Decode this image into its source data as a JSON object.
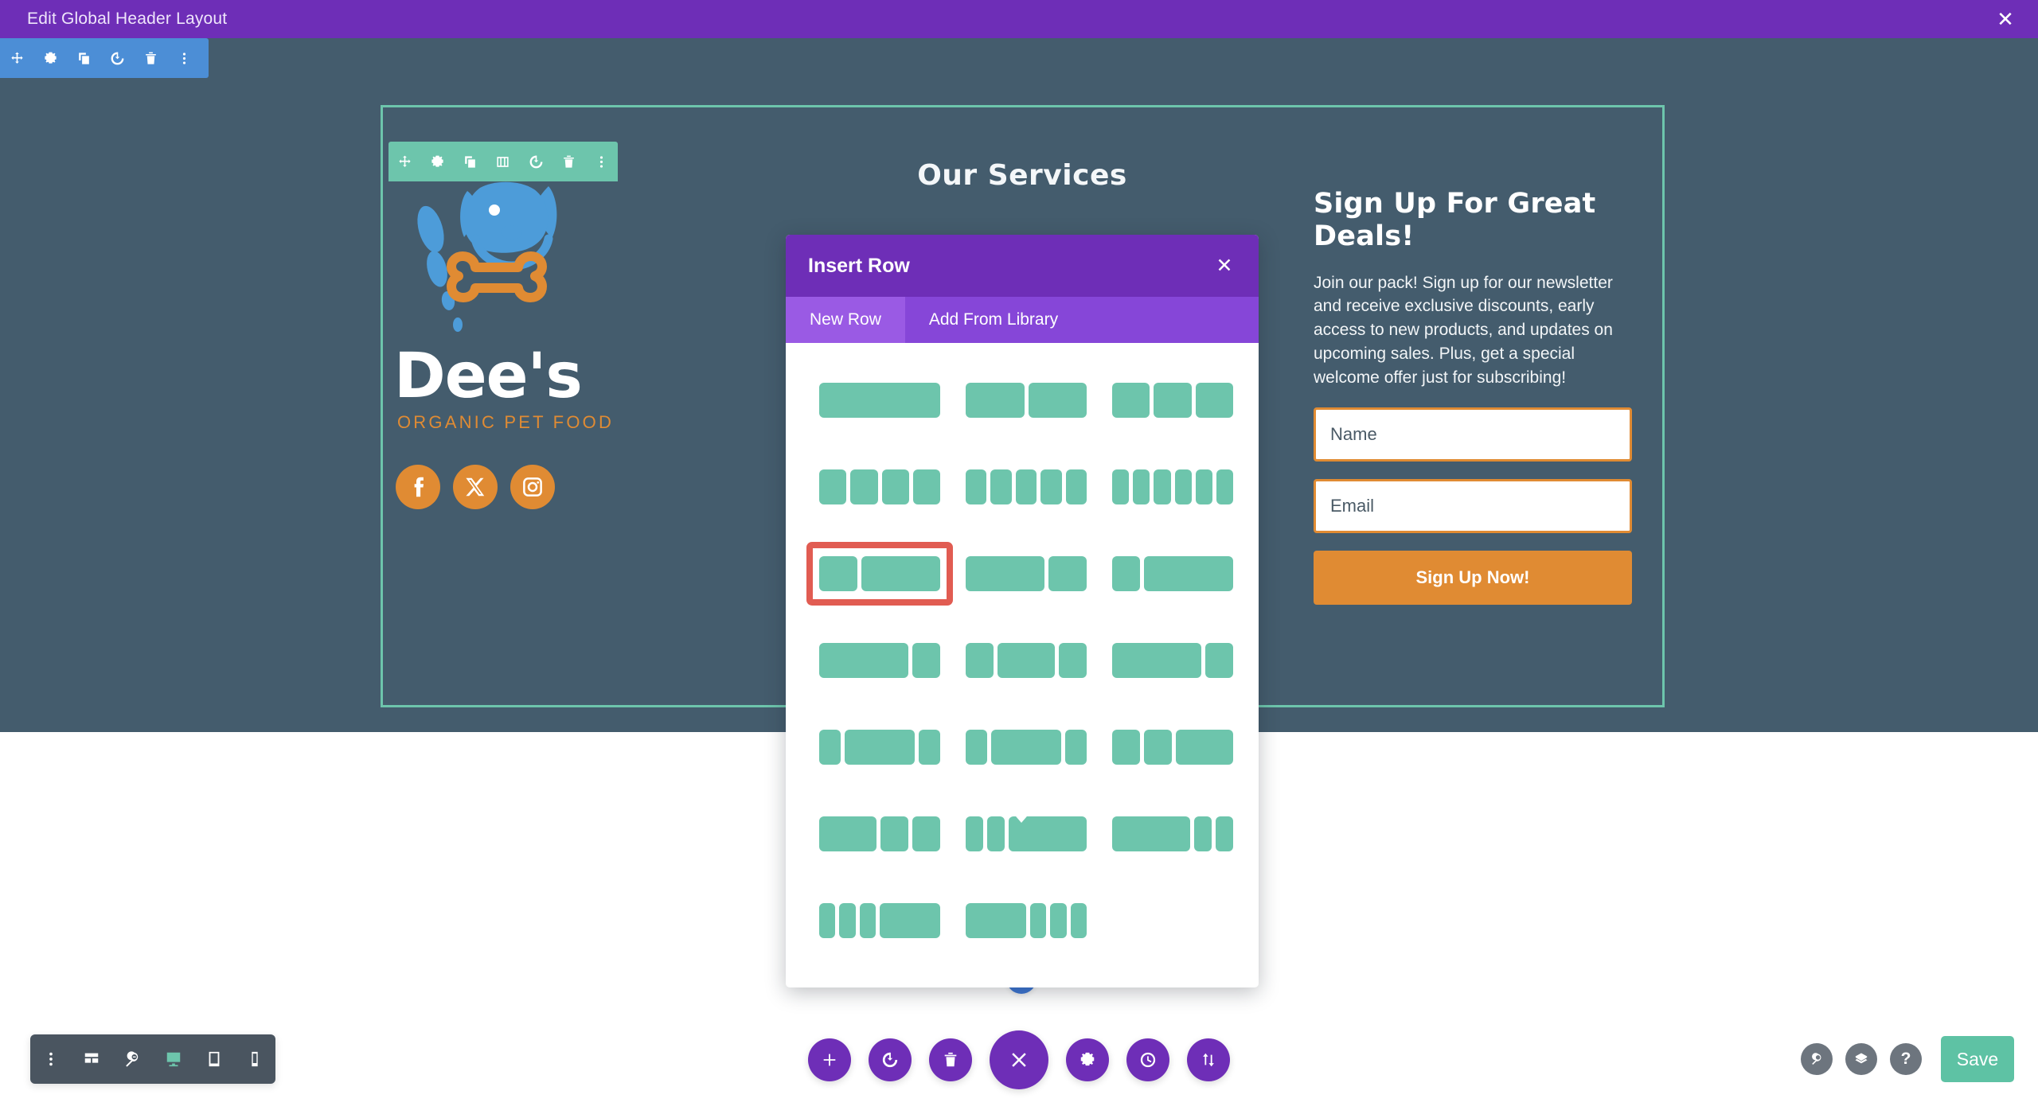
{
  "topbar": {
    "title": "Edit Global Header Layout",
    "close_icon": "close-icon",
    "close_label": "✕"
  },
  "colors": {
    "admin_purple": "#6e2eb7",
    "tab_purple": "#8646d8",
    "tab_active_purple": "#9a5ae4",
    "module_blue": "#4c8ed6",
    "row_teal": "#6dc5ac",
    "hero_slate": "#445c6d",
    "brand_orange": "#e08b33",
    "logo_blue": "#4d9cd9",
    "selected_red": "#e15c52",
    "save_teal": "#5ec2a4",
    "bottom_bar_slate": "#4a5560",
    "bottom_right_gray": "#6d757e"
  },
  "module_toolbar": {
    "name": "module-settings-toolbar",
    "buttons": [
      {
        "icon": "move-icon",
        "label": "Move"
      },
      {
        "icon": "gear-icon",
        "label": "Settings"
      },
      {
        "icon": "duplicate-icon",
        "label": "Duplicate"
      },
      {
        "icon": "power-icon",
        "label": "Disable"
      },
      {
        "icon": "trash-icon",
        "label": "Delete"
      },
      {
        "icon": "ellipsis-vertical-icon",
        "label": "More"
      }
    ]
  },
  "row_toolbar": {
    "name": "row-settings-toolbar",
    "buttons": [
      {
        "icon": "move-icon",
        "label": "Move"
      },
      {
        "icon": "gear-icon",
        "label": "Settings"
      },
      {
        "icon": "duplicate-icon",
        "label": "Duplicate"
      },
      {
        "icon": "columns-icon",
        "label": "Column Structure"
      },
      {
        "icon": "power-icon",
        "label": "Disable"
      },
      {
        "icon": "trash-icon",
        "label": "Delete"
      },
      {
        "icon": "ellipsis-vertical-icon",
        "label": "More"
      }
    ]
  },
  "hero": {
    "logo": {
      "brand": "Dee's",
      "tagline": "ORGANIC PET FOOD",
      "icon": "dog-head-with-bone-icon"
    },
    "socials": [
      {
        "icon": "facebook-icon",
        "label": "Facebook"
      },
      {
        "icon": "x-twitter-icon",
        "label": "X"
      },
      {
        "icon": "instagram-icon",
        "label": "Instagram"
      }
    ],
    "services_heading": "Our Services",
    "signup": {
      "heading": "Sign Up For Great Deals!",
      "body": "Join our pack! Sign up for our newsletter and receive exclusive discounts, early access to new products, and updates on upcoming sales. Plus, get a special welcome offer just for subscribing!",
      "name_placeholder": "Name",
      "name_value": "",
      "email_placeholder": "Email",
      "email_value": "",
      "submit_label": "Sign Up Now!"
    }
  },
  "add_buttons": {
    "add_row_label": "+",
    "add_row_name": "add-row-button",
    "add_section_label": "+",
    "add_section_name": "add-section-button"
  },
  "modal": {
    "title": "Insert Row",
    "close_label": "✕",
    "tabs": [
      {
        "label": "New Row",
        "active": true
      },
      {
        "label": "Add From Library",
        "active": false
      }
    ],
    "layouts": [
      {
        "name": "4_4_4",
        "widths": [
          100
        ],
        "selected": false
      },
      {
        "name": "1_2__1_2",
        "widths": [
          49,
          49
        ],
        "selected": false
      },
      {
        "name": "1_3__1_3__1_3",
        "widths": [
          32,
          32,
          32
        ],
        "selected": false
      },
      {
        "name": "1_4_x4",
        "widths": [
          23.5,
          23.5,
          23.5,
          23.5
        ],
        "selected": false
      },
      {
        "name": "1_5_x5",
        "widths": [
          18.4,
          18.4,
          18.4,
          18.4,
          18.4
        ],
        "selected": false
      },
      {
        "name": "1_6_x6",
        "widths": [
          15,
          15,
          15,
          15,
          15,
          15
        ],
        "selected": false
      },
      {
        "name": "1_3__2_3",
        "widths": [
          32,
          66
        ],
        "selected": true
      },
      {
        "name": "2_3__1_3",
        "widths": [
          66,
          32
        ],
        "selected": false
      },
      {
        "name": "1_4__3_4",
        "widths": [
          23.5,
          74.5
        ],
        "selected": false
      },
      {
        "name": "3_4__1_4",
        "widths": [
          74.5,
          23.5
        ],
        "selected": false
      },
      {
        "name": "1_4__1_2__1_4",
        "widths": [
          23.5,
          49,
          23.5
        ],
        "selected": false
      },
      {
        "name": "3_5__2_5",
        "widths": [
          74.5,
          23.5
        ],
        "selected": false
      },
      {
        "name": "1_5__3_5__1_5",
        "widths": [
          18,
          60,
          18
        ],
        "selected": false
      },
      {
        "name": "1_5__3_5__1_5b",
        "widths": [
          18,
          60,
          18
        ],
        "selected": false
      },
      {
        "name": "1_4__1_4__1_2",
        "widths": [
          23.5,
          23.5,
          49
        ],
        "selected": false
      },
      {
        "name": "1_2__1_4__1_4",
        "widths": [
          49,
          23.5,
          23.5
        ],
        "selected": false
      },
      {
        "name": "1_6__1_6__2_3",
        "widths": [
          15,
          15,
          66
        ],
        "selected": false
      },
      {
        "name": "2_3__1_6__1_6",
        "widths": [
          66,
          15,
          15
        ],
        "selected": false
      },
      {
        "name": "1_6_x3__1_2",
        "widths": [
          14,
          14,
          14,
          52
        ],
        "selected": false
      },
      {
        "name": "1_2__1_6_x3",
        "widths": [
          52,
          14,
          14,
          14
        ],
        "selected": false
      }
    ]
  },
  "bottom_left_bar": {
    "items": [
      {
        "icon": "ellipsis-vertical-icon",
        "label": "More Options",
        "active": false
      },
      {
        "icon": "wireframe-icon",
        "label": "Wireframe View",
        "active": false
      },
      {
        "icon": "zoom-out-icon",
        "label": "Zoom Out",
        "active": false
      },
      {
        "icon": "desktop-icon",
        "label": "Desktop View",
        "active": true
      },
      {
        "icon": "tablet-icon",
        "label": "Tablet View",
        "active": false
      },
      {
        "icon": "phone-icon",
        "label": "Phone View",
        "active": false
      }
    ]
  },
  "bottom_center_bar": {
    "items": [
      {
        "icon": "plus-icon",
        "label": "Add New Section",
        "big": false
      },
      {
        "icon": "power-icon",
        "label": "Toggle Editor",
        "big": false
      },
      {
        "icon": "trash-icon",
        "label": "Clear Layout",
        "big": false
      },
      {
        "icon": "close-icon",
        "label": "Close Settings",
        "big": true
      },
      {
        "icon": "gear-icon",
        "label": "Page Settings",
        "big": false
      },
      {
        "icon": "history-icon",
        "label": "Editing History",
        "big": false
      },
      {
        "icon": "sort-arrows-icon",
        "label": "Portability",
        "big": false
      }
    ]
  },
  "bottom_right_bar": {
    "items": [
      {
        "icon": "search-icon",
        "label": "Search"
      },
      {
        "icon": "layers-icon",
        "label": "Layers"
      },
      {
        "icon": "help-icon",
        "label": "?"
      }
    ],
    "save_label": "Save"
  }
}
